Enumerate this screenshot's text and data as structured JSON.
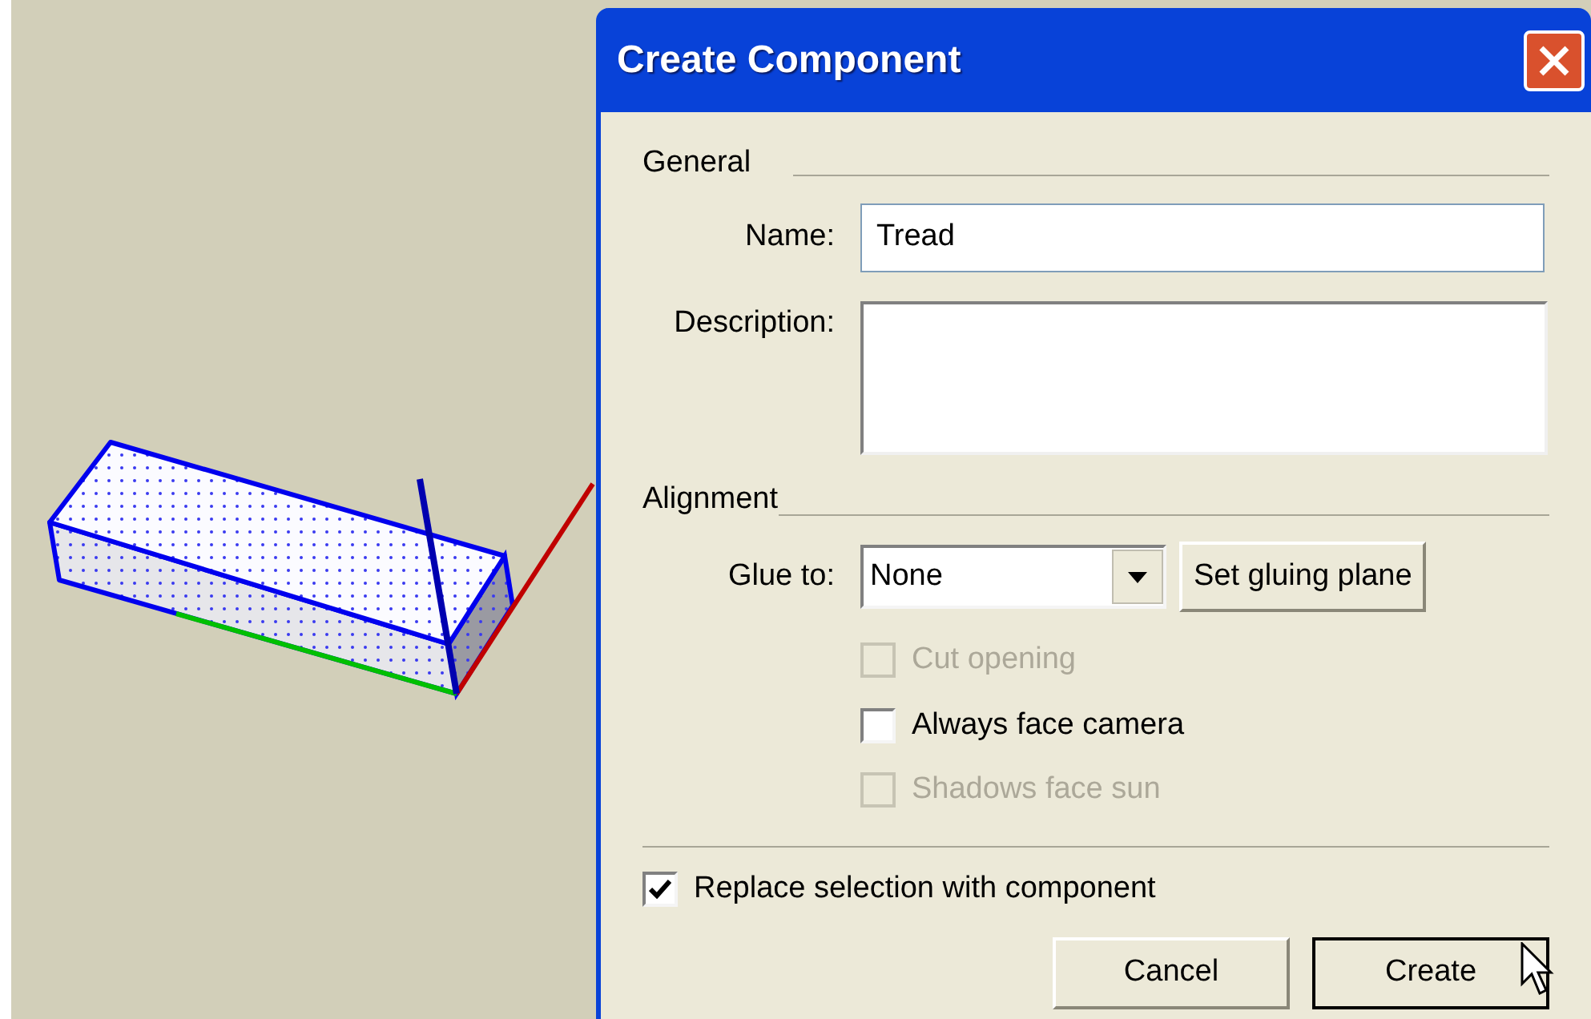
{
  "window": {
    "title": "Create Component"
  },
  "general": {
    "heading": "General",
    "name": {
      "label": "Name:",
      "value": "Tread"
    },
    "description": {
      "label": "Description:"
    }
  },
  "alignment": {
    "heading": "Alignment",
    "glue_to": {
      "label": "Glue to:",
      "value": "None"
    },
    "set_gluing_plane_button": "Set gluing plane",
    "options": [
      {
        "label": "Cut opening",
        "checked": false,
        "disabled": true
      },
      {
        "label": "Always face camera",
        "checked": false,
        "disabled": false
      },
      {
        "label": "Shadows face sun",
        "checked": false,
        "disabled": true
      }
    ]
  },
  "replace_selection": {
    "label": "Replace selection with component",
    "checked": true
  },
  "buttons": [
    {
      "label": "Cancel",
      "default": false
    },
    {
      "label": "Create",
      "default": true
    }
  ]
}
